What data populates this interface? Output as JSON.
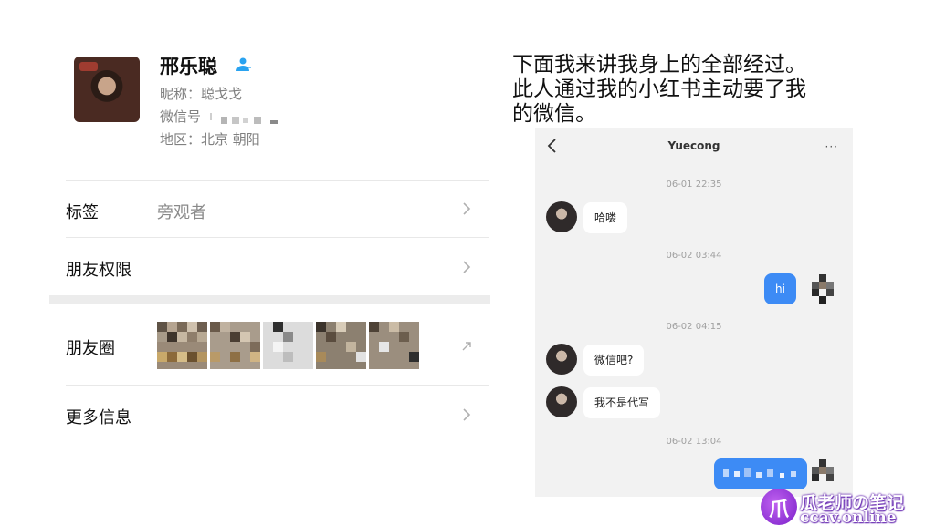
{
  "profile": {
    "name": "邢乐聪",
    "nickname": "昵称：聪戈戈",
    "wechat_id_label": "微信号",
    "region": "地区：北京 朝阳",
    "rows": {
      "tags_label": "标签",
      "tags_value": "旁观者",
      "permissions_label": "朋友权限",
      "moments_label": "朋友圈",
      "more_label": "更多信息"
    }
  },
  "caption": {
    "line1": "下面我来讲我身上的全部经过。",
    "line2": "此人通过我的小红书主动要了我",
    "line3": "的微信。"
  },
  "chat": {
    "title": "Yuecong",
    "more": "···",
    "messages": [
      {
        "time": "06-01 22:35",
        "text": "哈喽",
        "from": "them"
      },
      {
        "time": "06-02 03:44",
        "text": "hi",
        "from": "me"
      },
      {
        "time": "06-02 04:15",
        "text": "微信吧?",
        "from": "them"
      },
      {
        "time": "",
        "text": "我不是代写",
        "from": "them"
      },
      {
        "time": "06-02 13:04",
        "text": "",
        "from": "me"
      }
    ]
  },
  "watermark": {
    "logo": "爪",
    "text": "瓜老师の笔记",
    "url": "ccav.online"
  },
  "colors": {
    "accent_blue": "#3d8bf5",
    "verified_blue": "#2aa3f0",
    "watermark_purple": "#7a1fc9"
  }
}
